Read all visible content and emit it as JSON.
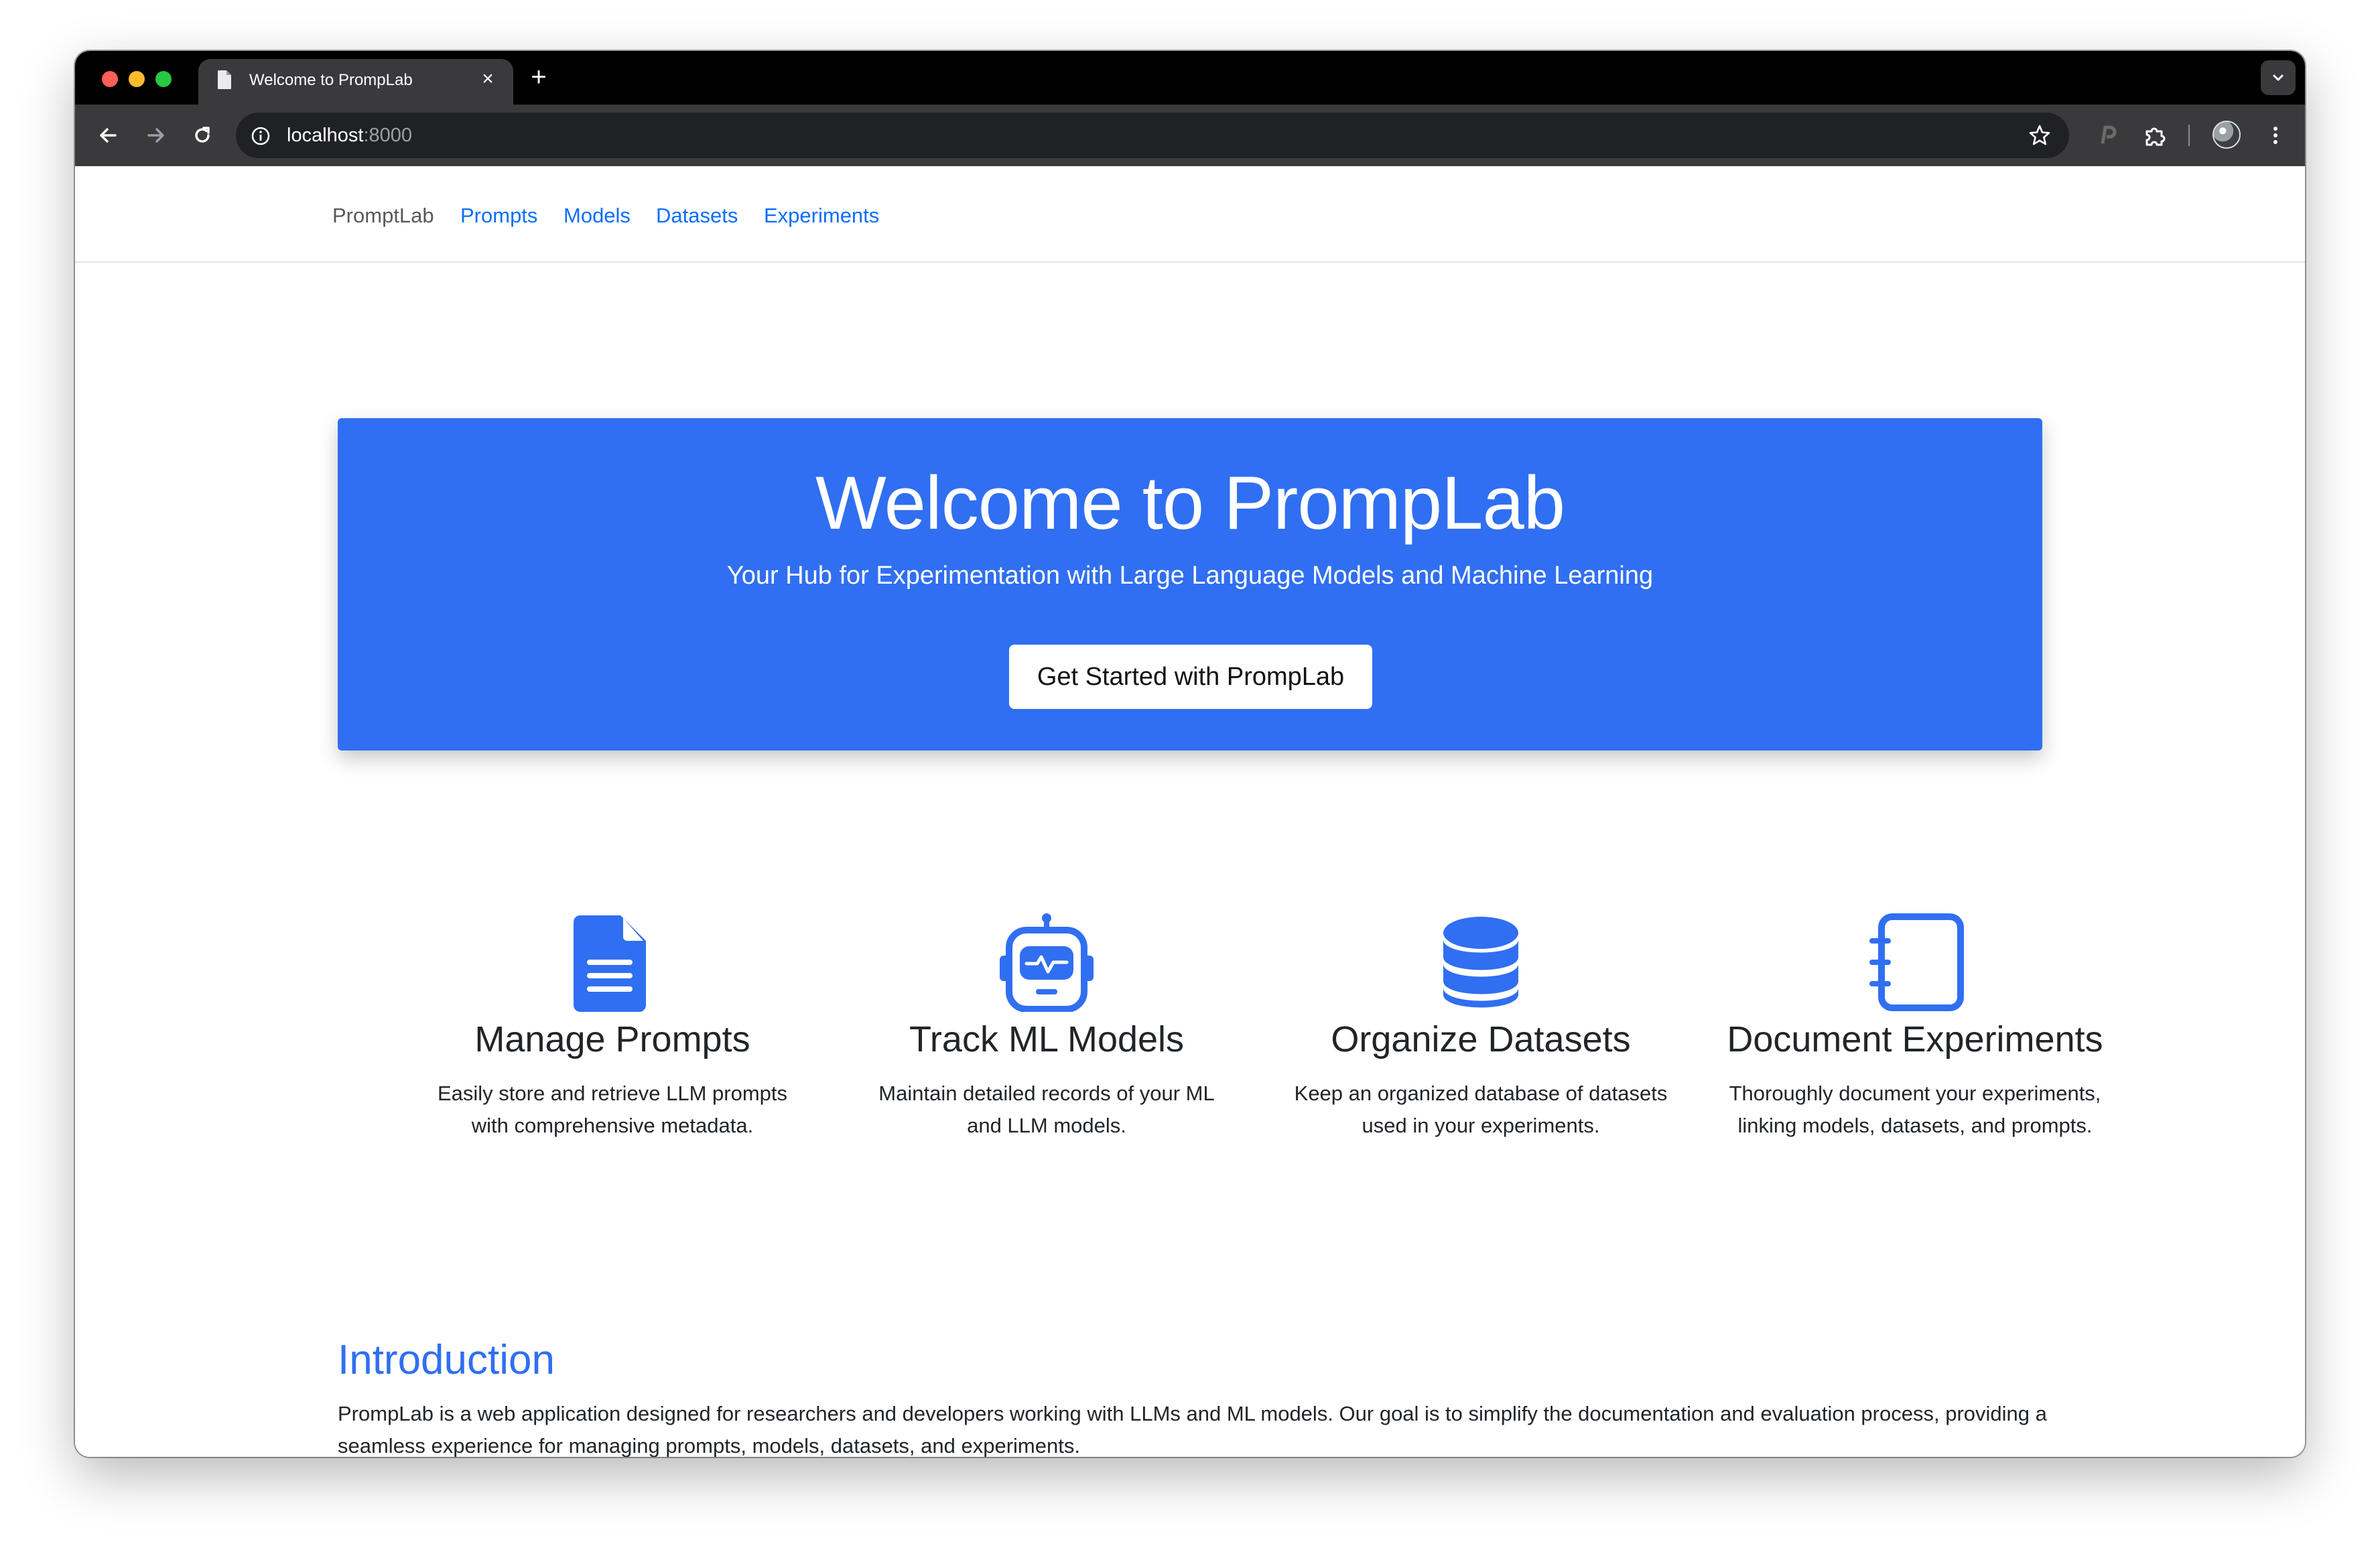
{
  "browser": {
    "tab_title": "Welcome to PrompLab",
    "tab_close": "×",
    "new_tab": "+",
    "url_host": "localhost",
    "url_port": ":8000",
    "icons": [
      "back-arrow-icon",
      "forward-arrow-icon",
      "reload-icon",
      "site-info-icon",
      "bookmark-star-icon",
      "extension-p-icon",
      "extensions-puzzle-icon",
      "profile-avatar-icon",
      "kebab-menu-icon",
      "tab-search-chevron-icon"
    ]
  },
  "navbar": {
    "brand": "PromptLab",
    "links": [
      "Prompts",
      "Models",
      "Datasets",
      "Experiments"
    ]
  },
  "hero": {
    "title": "Welcome to PrompLab",
    "subtitle": "Your Hub for Experimentation with Large Language Models and Machine Learning",
    "button": "Get Started with PrompLab",
    "background": "#306ff1"
  },
  "features": [
    {
      "icon": "document-icon",
      "title": "Manage Prompts",
      "desc": "Easily store and retrieve LLM prompts with comprehensive metadata."
    },
    {
      "icon": "robot-icon",
      "title": "Track ML Models",
      "desc": "Maintain detailed records of your ML and LLM models."
    },
    {
      "icon": "database-icon",
      "title": "Organize Datasets",
      "desc": "Keep an organized database of datasets used in your experiments."
    },
    {
      "icon": "notebook-icon",
      "title": "Document Experiments",
      "desc": "Thoroughly document your experiments, linking models, datasets, and prompts."
    }
  ],
  "intro": {
    "heading": "Introduction",
    "text": "PrompLab is a web application designed for researchers and developers working with LLMs and ML models. Our goal is to simplify the documentation and evaluation process, providing a seamless experience for managing prompts, models, datasets, and experiments."
  },
  "colors": {
    "accent": "#306ff1",
    "link": "#0d6efd",
    "text": "#212529"
  }
}
